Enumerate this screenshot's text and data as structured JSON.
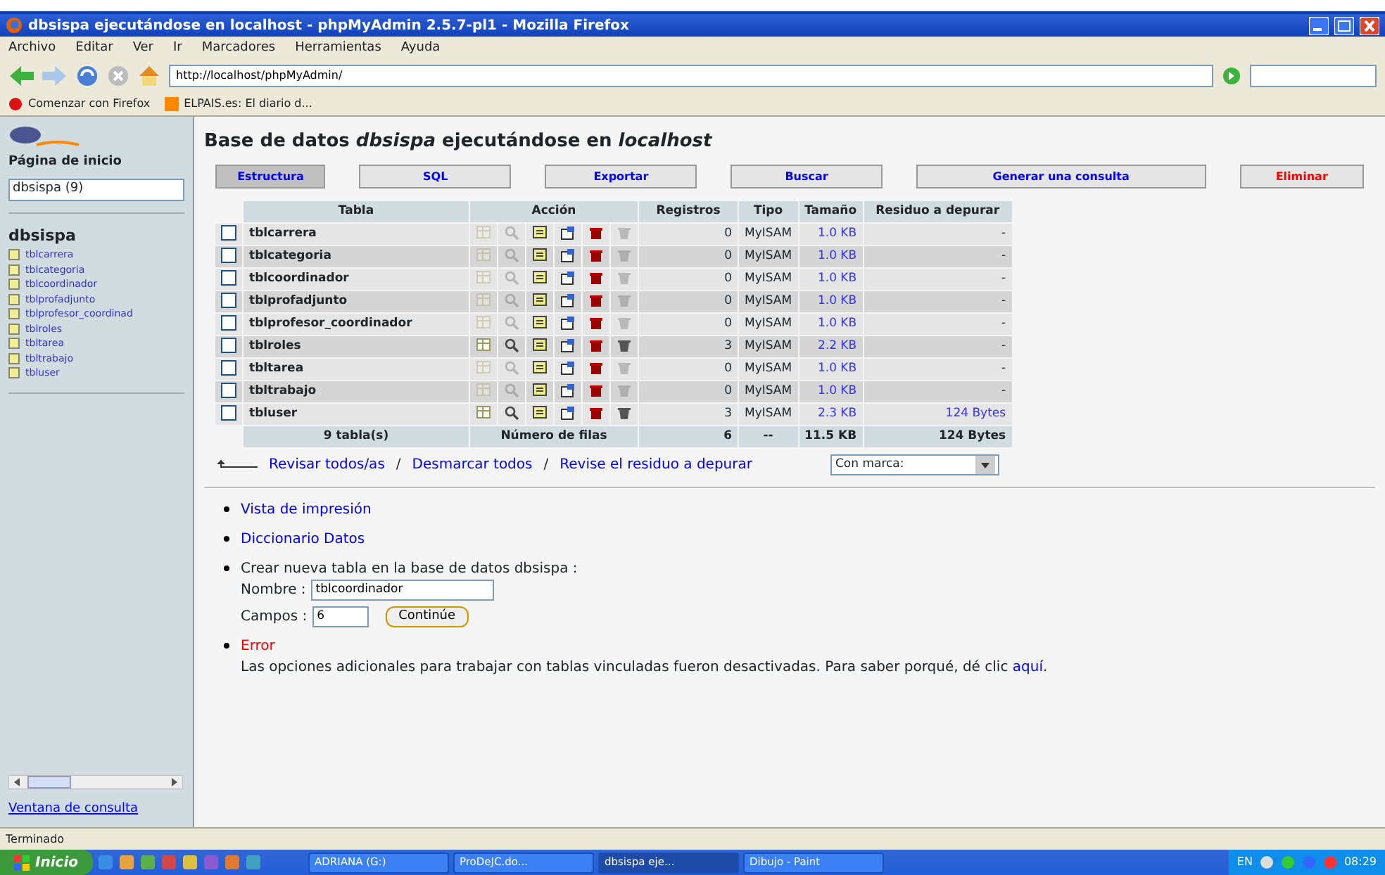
{
  "window": {
    "title": "dbsispa ejecutándose en localhost - phpMyAdmin 2.5.7-pl1 - Mozilla Firefox"
  },
  "menu": [
    "Archivo",
    "Editar",
    "Ver",
    "Ir",
    "Marcadores",
    "Herramientas",
    "Ayuda"
  ],
  "address": {
    "value": "http://localhost/phpMyAdmin/"
  },
  "bookmarks": [
    "Comenzar con Firefox",
    "ELPAIS.es: El diario d..."
  ],
  "sidebar": {
    "home": "Página de inicio",
    "database_select": "dbsispa (9)",
    "database": "dbsispa",
    "tables": [
      "tblcarrera",
      "tblcategoria",
      "tblcoordinador",
      "tblprofadjunto",
      "tblprofesor_coordinad",
      "tblroles",
      "tbltarea",
      "tbltrabajo",
      "tbluser"
    ],
    "query_window_link": "Ventana de consulta"
  },
  "heading": "Base de datos *dbsispa* ejecutándose en *localhost*",
  "tabs": [
    {
      "label": "Estructura",
      "selected": true,
      "danger": false
    },
    {
      "label": "SQL",
      "selected": false,
      "danger": false
    },
    {
      "label": "Exportar",
      "selected": false,
      "danger": false
    },
    {
      "label": "Buscar",
      "selected": false,
      "danger": false
    },
    {
      "label": "Generar una consulta",
      "selected": false,
      "danger": false
    },
    {
      "label": "Eliminar",
      "selected": false,
      "danger": true
    }
  ],
  "table": {
    "columns": [
      "Tabla",
      "Acción",
      "Registros",
      "Tipo",
      "Tamaño",
      "Residuo a depurar"
    ],
    "rows": [
      {
        "name": "tblcarrera",
        "records": "0",
        "type": "MyISAM",
        "size": "1.0 KB",
        "overhead": "-",
        "empty": true,
        "checked": false
      },
      {
        "name": "tblcategoria",
        "records": "0",
        "type": "MyISAM",
        "size": "1.0 KB",
        "overhead": "-",
        "empty": true,
        "checked": false
      },
      {
        "name": "tblcoordinador",
        "records": "0",
        "type": "MyISAM",
        "size": "1.0 KB",
        "overhead": "-",
        "empty": true,
        "checked": false
      },
      {
        "name": "tblprofadjunto",
        "records": "0",
        "type": "MyISAM",
        "size": "1.0 KB",
        "overhead": "-",
        "empty": true,
        "checked": false
      },
      {
        "name": "tblprofesor_coordinador",
        "records": "0",
        "type": "MyISAM",
        "size": "1.0 KB",
        "overhead": "-",
        "empty": true,
        "checked": false
      },
      {
        "name": "tblroles",
        "records": "3",
        "type": "MyISAM",
        "size": "2.2 KB",
        "overhead": "-",
        "empty": false,
        "checked": false
      },
      {
        "name": "tbltarea",
        "records": "0",
        "type": "MyISAM",
        "size": "1.0 KB",
        "overhead": "-",
        "empty": true,
        "checked": false
      },
      {
        "name": "tbltrabajo",
        "records": "0",
        "type": "MyISAM",
        "size": "1.0 KB",
        "overhead": "-",
        "empty": true,
        "checked": false
      },
      {
        "name": "tbluser",
        "records": "3",
        "type": "MyISAM",
        "size": "2.3 KB",
        "overhead": "124 Bytes",
        "empty": false,
        "checked": false
      }
    ],
    "footer": [
      "9 tabla(s)",
      "Número de filas",
      "6",
      "--",
      "11.5 KB",
      "124 Bytes"
    ]
  },
  "select_links": [
    "Revisar todos/as",
    "Desmarcar todos",
    "Revise el residuo a depurar"
  ],
  "select_separators": [
    "/",
    "/"
  ],
  "with_selected": {
    "value": "Con marca:"
  },
  "links": [
    "Vista de impresión",
    "Diccionario Datos"
  ],
  "create_table": {
    "label": "Crear nueva tabla en la base de datos dbsispa :",
    "name_label": "Nombre :",
    "name_value": "tblcoordinador",
    "fields_label": "Campos :",
    "fields_value": "6",
    "button": "Continúe"
  },
  "error": {
    "title": "Error",
    "message": "Las opciones adicionales para trabajar con tablas vinculadas fueron desactivadas. Para saber porqué, dé clic ",
    "link": "aquí",
    "end": "."
  },
  "status_bar": "Terminado",
  "taskbar": {
    "start": "Inicio",
    "tasks": [
      {
        "label": "ADRIANA (G:)",
        "selected": false
      },
      {
        "label": "ProDeJC.do...",
        "selected": false
      },
      {
        "label": "dbsispa eje...",
        "selected": true
      },
      {
        "label": "Dibujo - Paint",
        "selected": false
      }
    ],
    "language": "EN",
    "clock": "08:29"
  }
}
